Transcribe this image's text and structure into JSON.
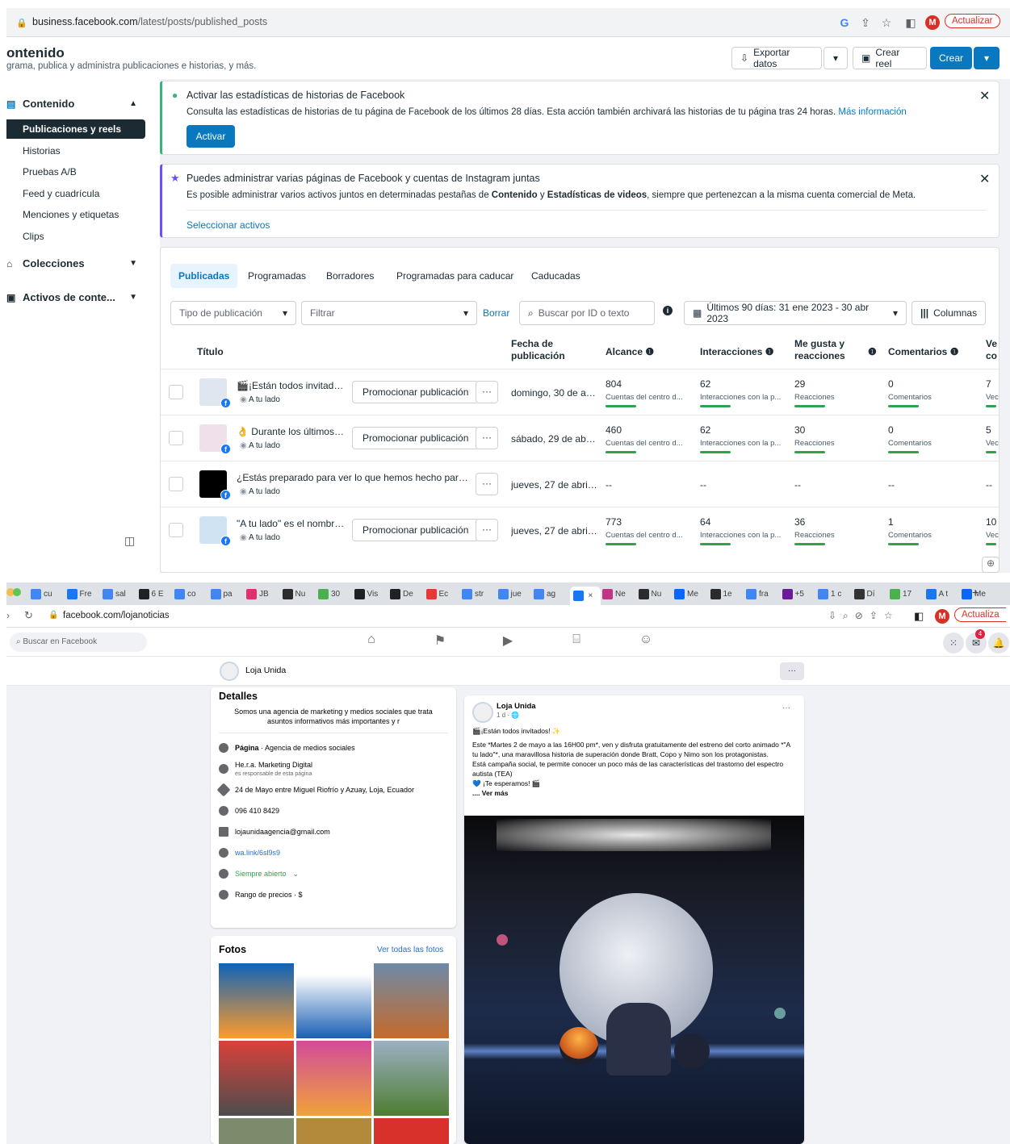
{
  "top_browser": {
    "url_domain": "business.facebook.com",
    "url_path": "/latest/posts/published_posts",
    "profile_initial": "M",
    "update_label": "Actualizar"
  },
  "suite": {
    "title": "ontenido",
    "subtitle": "grama, publica y administra publicaciones e historias, y más.",
    "export_label": "Exportar datos",
    "reel_label": "Crear reel",
    "create_label": "Crear",
    "sidebar": {
      "group_content": "Contenido",
      "items": [
        "Publicaciones y reels",
        "Historias",
        "Pruebas A/B",
        "Feed y cuadrícula",
        "Menciones y etiquetas",
        "Clips"
      ],
      "group_collections": "Colecciones",
      "group_assets": "Activos de conte..."
    },
    "banner1": {
      "title": "Activar las estadísticas de historias de Facebook",
      "body": "Consulta las estadísticas de historias de tu página de Facebook de los últimos 28 días. Esta acción también archivará las historias de tu página tras 24 horas.",
      "link": "Más información",
      "button": "Activar",
      "accent": "#36b37e"
    },
    "banner2": {
      "title": "Puedes administrar varias páginas de Facebook y cuentas de Instagram juntas",
      "body_pre": "Es posible administrar varios activos juntos en determinadas pestañas de ",
      "body_b1": "Contenido",
      "body_mid": " y ",
      "body_b2": "Estadísticas de videos",
      "body_post": ", siempre que pertenezcan a la misma cuenta comercial de Meta.",
      "link": "Seleccionar activos",
      "accent": "#6b4eff"
    },
    "tabs": [
      "Publicadas",
      "Programadas",
      "Borradores",
      "Programadas para caducar",
      "Caducadas"
    ],
    "filters": {
      "type": "Tipo de publicación",
      "filter": "Filtrar",
      "clear": "Borrar",
      "search_placeholder": "Buscar por ID o texto",
      "date_range": "Últimos 90 días: 31 ene 2023 - 30 abr 2023",
      "columns": "Columnas"
    },
    "columns": {
      "title": "Título",
      "date": "Fecha de publicación",
      "reach": "Alcance",
      "interactions": "Interacciones",
      "likes": "Me gusta y reacciones",
      "comments": "Comentarios",
      "views": "Ve co"
    },
    "promote_label": "Promocionar publicación",
    "rows": [
      {
        "title": "🎬¡Están todos invitados!...",
        "page": "A tu lado",
        "promote": true,
        "date": "domingo, 30 de ab...",
        "reach": "804",
        "reach_sub": "Cuentas del centro d...",
        "inter": "62",
        "inter_sub": "Interacciones con la p...",
        "likes": "29",
        "likes_sub": "Reacciones",
        "comments": "0",
        "comments_sub": "Comentarios",
        "views": "7",
        "views_sub": "Vec",
        "thumb": "#dfe6f0"
      },
      {
        "title": "👌 Durante los últimos a...",
        "page": "A tu lado",
        "promote": true,
        "date": "sábado, 29 de abri...",
        "reach": "460",
        "reach_sub": "Cuentas del centro d...",
        "inter": "62",
        "inter_sub": "Interacciones con la p...",
        "likes": "30",
        "likes_sub": "Reacciones",
        "comments": "0",
        "comments_sub": "Comentarios",
        "views": "5",
        "views_sub": "Vec",
        "thumb": "#f0e0ea"
      },
      {
        "title": "¿Estás preparado para ver lo que hemos hecho para ti? ...",
        "page": "A tu lado",
        "promote": false,
        "date": "jueves, 27 de abril ...",
        "reach": "--",
        "reach_sub": "",
        "inter": "--",
        "inter_sub": "",
        "likes": "--",
        "likes_sub": "",
        "comments": "--",
        "comments_sub": "",
        "views": "--",
        "views_sub": "",
        "thumb": "#000000"
      },
      {
        "title": "\"A tu lado\" es el nombre ...",
        "page": "A tu lado",
        "promote": true,
        "date": "jueves, 27 de abril ...",
        "reach": "773",
        "reach_sub": "Cuentas del centro d...",
        "inter": "64",
        "inter_sub": "Interacciones con la p...",
        "likes": "36",
        "likes_sub": "Reacciones",
        "comments": "1",
        "comments_sub": "Comentarios",
        "views": "10",
        "views_sub": "Vec",
        "thumb": "#cfe3f2"
      }
    ]
  },
  "bottom_browser": {
    "tabs": [
      "cu",
      "Fre",
      "sal",
      "6 E",
      "co",
      "pa",
      "JB",
      "Nu",
      "30",
      "Vis",
      "De",
      "Ec",
      "str",
      "jue",
      "ag",
      "",
      "Ne",
      "Nu",
      "Me",
      "1e",
      "fra",
      "+5",
      "1 c",
      "Dí",
      "17",
      "A t",
      "Me"
    ],
    "tab_close": "×",
    "new_tab": "+",
    "url": "facebook.com/lojanoticias",
    "update_label": "Actualiza",
    "profile_initial": "M"
  },
  "fb": {
    "search_placeholder": "Buscar en Facebook",
    "notif_count": "4",
    "page_name": "Loja Unida",
    "more": "···",
    "details": {
      "heading": "Detalles",
      "intro": "Somos una agencia de marketing y medios sociales que trata asuntos informativos más importantes y r",
      "category_label": "Página",
      "category": " · Agencia de medios sociales",
      "responsible": "He.r.a. Marketing Digital",
      "responsible_sub": "es responsable de esta página",
      "address": "24 de Mayo entre Miguel Riofrío y Azuay, Loja, Ecuador",
      "phone": "096 410 8429",
      "email": "lojaunidaagencia@gmail.com",
      "link": "wa.link/6sl9s9",
      "hours": "Siempre abierto",
      "price": "Rango de precios · $"
    },
    "photos": {
      "heading": "Fotos",
      "see_all": "Ver todas las fotos"
    },
    "post": {
      "author": "Loja Unida",
      "meta": "1 d · 🌐",
      "line1": "🎬¡Están todos invitados! ✨",
      "body": "Este *Martes 2 de mayo a las 16H00 pm*, ven y disfruta gratuitamente del estreno del corto animado *\"A tu lado\"*, una maravillosa historia de superación donde Bratt, Copo y Nimo son los protagonistas.",
      "body2": "Está campaña social, te permite conocer un poco más de las características del trastorno del espectro autista (TEA)",
      "body3": "💙 ¡Te esperamos! 🎬",
      "more": ".... Ver más"
    }
  }
}
